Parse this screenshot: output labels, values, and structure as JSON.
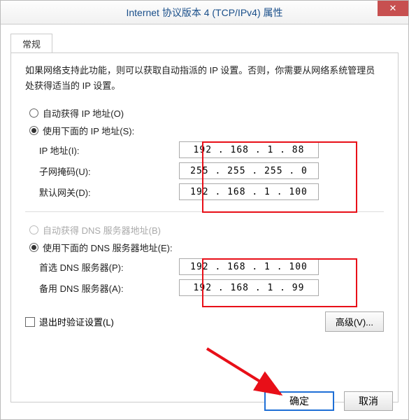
{
  "window": {
    "title": "Internet 协议版本 4 (TCP/IPv4) 属性",
    "close": "✕"
  },
  "tabs": {
    "general": "常规"
  },
  "description": "如果网络支持此功能，则可以获取自动指派的 IP 设置。否则，你需要从网络系统管理员处获得适当的 IP 设置。",
  "ipGroup": {
    "auto": "自动获得 IP 地址(O)",
    "manual": "使用下面的 IP 地址(S):",
    "ipLabel": "IP 地址(I):",
    "ipValue": "192 . 168 .  1  .  88",
    "maskLabel": "子网掩码(U):",
    "maskValue": "255 . 255 . 255 .  0",
    "gwLabel": "默认网关(D):",
    "gwValue": "192 . 168 .  1  . 100"
  },
  "dnsGroup": {
    "auto": "自动获得 DNS 服务器地址(B)",
    "manual": "使用下面的 DNS 服务器地址(E):",
    "primLabel": "首选 DNS 服务器(P):",
    "primValue": "192 . 168 .  1  . 100",
    "altLabel": "备用 DNS 服务器(A):",
    "altValue": "192 . 168 .  1  .  99"
  },
  "validate": "退出时验证设置(L)",
  "advanced": "高级(V)...",
  "ok": "确定",
  "cancel": "取消"
}
